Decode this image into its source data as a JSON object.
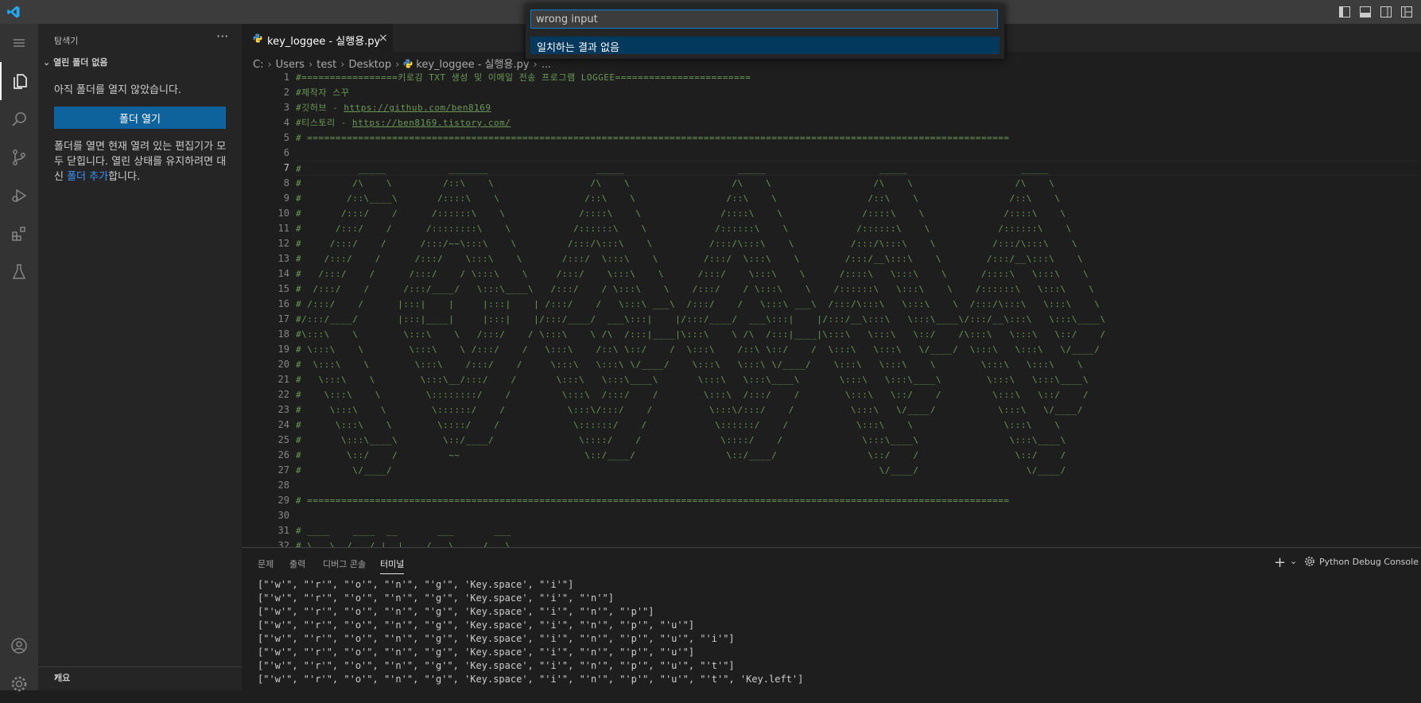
{
  "quick_input": {
    "value": "wrong input",
    "result": "일치하는 결과 없음"
  },
  "sidebar": {
    "title": "탐색기",
    "more": "···",
    "section": "열린 폴더 없음",
    "message": "아직 폴더를 열지 않았습니다.",
    "open_button": "폴더 열기",
    "desc_before": "폴더를 열면 현재 열려 있는 편집기가 모두 닫힙니다. 열린 상태를 유지하려면 대신 ",
    "desc_link": "폴더 추가",
    "desc_after": "합니다.",
    "outline": "개요"
  },
  "tab": {
    "label": "key_loggee - 실행용.py",
    "close": "×"
  },
  "breadcrumb": [
    "C:",
    "Users",
    "test",
    "Desktop",
    "key_loggee - 실행용.py",
    "..."
  ],
  "editor": {
    "current_line": 7,
    "lines": [
      "#=================키로깅 TXT 생성 및 이메일 전송 프로그램 LOGGEE========================",
      "#제작자 스꾸",
      "#깃허브 - https://github.com/ben8169",
      "#티스토리 - https://ben8169.tistory.com/",
      "# ============================================================================================================================",
      "",
      "#          _____           _______                   _____                    _____                    _____                    _____",
      "#         /\\    \\         /::\\    \\                 /\\    \\                  /\\    \\                  /\\    \\                  /\\    \\",
      "#        /::\\____\\       /::::\\    \\               /::\\    \\                /::\\    \\                /::\\    \\                /::\\    \\",
      "#       /:::/    /      /::::::\\    \\             /::::\\    \\              /::::\\    \\              /::::\\    \\              /::::\\    \\",
      "#      /:::/    /      /::::::::\\    \\           /::::::\\    \\            /::::::\\    \\            /::::::\\    \\            /::::::\\    \\",
      "#     /:::/    /      /:::/~~\\:::\\    \\         /:::/\\:::\\    \\          /:::/\\:::\\    \\          /:::/\\:::\\    \\          /:::/\\:::\\    \\",
      "#    /:::/    /      /:::/    \\:::\\    \\       /:::/  \\:::\\    \\        /:::/  \\:::\\    \\        /:::/__\\:::\\    \\        /:::/__\\:::\\    \\",
      "#   /:::/    /      /:::/    / \\:::\\    \\     /:::/    \\:::\\    \\      /:::/    \\:::\\    \\      /::::\\   \\:::\\    \\      /::::\\   \\:::\\    \\",
      "#  /:::/    /      /:::/____/   \\:::\\____\\   /:::/    / \\:::\\    \\    /:::/    / \\:::\\    \\    /::::::\\   \\:::\\    \\    /::::::\\   \\:::\\    \\",
      "# /:::/    /      |:::|    |     |:::|    | /:::/    /   \\:::\\ ___\\  /:::/    /   \\:::\\ ___\\  /:::/\\:::\\   \\:::\\    \\  /:::/\\:::\\   \\:::\\    \\",
      "#/:::/____/       |:::|____|     |:::|    |/:::/____/  ___\\:::|    |/:::/____/  ___\\:::|    |/:::/__\\:::\\   \\:::\\____\\/:::/__\\:::\\   \\:::\\____\\",
      "#\\:::\\    \\        \\:::\\    \\   /:::/    / \\:::\\    \\ /\\  /:::|____|\\:::\\    \\ /\\  /:::|____|\\:::\\   \\:::\\   \\::/    /\\:::\\   \\:::\\   \\::/    /",
      "# \\:::\\    \\        \\:::\\    \\ /:::/    /   \\:::\\    /::\\ \\::/    /  \\:::\\    /::\\ \\::/    /  \\:::\\   \\:::\\   \\/____/  \\:::\\   \\:::\\   \\/____/",
      "#  \\:::\\    \\        \\:::\\    /:::/    /     \\:::\\   \\:::\\ \\/____/    \\:::\\   \\:::\\ \\/____/    \\:::\\   \\:::\\    \\        \\:::\\   \\:::\\    \\",
      "#   \\:::\\    \\        \\:::\\__/:::/    /       \\:::\\   \\:::\\____\\       \\:::\\   \\:::\\____\\       \\:::\\   \\:::\\____\\        \\:::\\   \\:::\\____\\",
      "#    \\:::\\    \\        \\::::::::/    /         \\:::\\  /:::/    /        \\:::\\  /:::/    /        \\:::\\   \\::/    /         \\:::\\   \\::/    /",
      "#     \\:::\\    \\        \\::::::/    /           \\:::\\/:::/    /          \\:::\\/:::/    /          \\:::\\   \\/____/           \\:::\\   \\/____/",
      "#      \\:::\\    \\        \\::::/    /             \\::::::/    /            \\::::::/    /            \\:::\\    \\                \\:::\\    \\",
      "#       \\:::\\____\\        \\::/____/               \\::::/    /              \\::::/    /              \\:::\\____\\                \\:::\\____\\",
      "#        \\::/    /         ~~                      \\::/____/                \\::/____/                \\::/    /                 \\::/    /",
      "#         \\/____/                                                                                      \\/____/                   \\/____/",
      "",
      "# ============================================================================================================================",
      "",
      "# ____    ____  __       ___       ___",
      "# \\   \\  /   / |  |    /   \\     /   \\"
    ]
  },
  "panel": {
    "tabs": [
      "문제",
      "출력",
      "디버그 콘솔",
      "터미널"
    ],
    "active_tab": "터미널",
    "add": "+",
    "chevron": "⌄",
    "debug_console": "Python Debug Console",
    "terminal_lines": [
      "[\"'w'\", \"'r'\", \"'o'\", \"'n'\", \"'g'\", 'Key.space', \"'i'\"]",
      "[\"'w'\", \"'r'\", \"'o'\", \"'n'\", \"'g'\", 'Key.space', \"'i'\", \"'n'\"]",
      "[\"'w'\", \"'r'\", \"'o'\", \"'n'\", \"'g'\", 'Key.space', \"'i'\", \"'n'\", \"'p'\"]",
      "[\"'w'\", \"'r'\", \"'o'\", \"'n'\", \"'g'\", 'Key.space', \"'i'\", \"'n'\", \"'p'\", \"'u'\"]",
      "[\"'w'\", \"'r'\", \"'o'\", \"'n'\", \"'g'\", 'Key.space', \"'i'\", \"'n'\", \"'p'\", \"'u'\", \"'i'\"]",
      "[\"'w'\", \"'r'\", \"'o'\", \"'n'\", \"'g'\", 'Key.space', \"'i'\", \"'n'\", \"'p'\", \"'u'\"]",
      "[\"'w'\", \"'r'\", \"'o'\", \"'n'\", \"'g'\", 'Key.space', \"'i'\", \"'n'\", \"'p'\", \"'u'\", \"'t'\"]",
      "[\"'w'\", \"'r'\", \"'o'\", \"'n'\", \"'g'\", 'Key.space', \"'i'\", \"'n'\", \"'p'\", \"'u'\", \"'t'\", 'Key.left']"
    ]
  },
  "colors": {
    "accent": "#0e639c",
    "comment": "#6a9955",
    "selection": "#04395e"
  }
}
